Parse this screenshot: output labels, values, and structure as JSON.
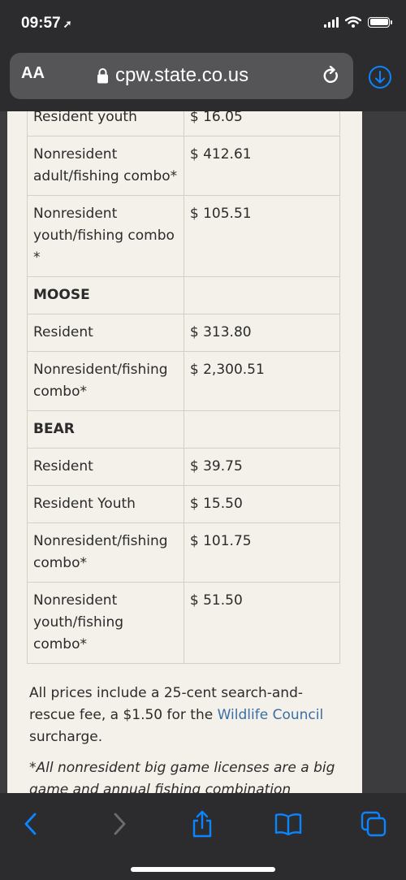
{
  "status_bar": {
    "time": "09:57",
    "location_arrow": "location-arrow-icon"
  },
  "address_bar": {
    "text_size_label": "AA",
    "url": "cpw.state.co.us"
  },
  "table": {
    "cut_row": {
      "label": "Resident youth",
      "price": "$ 16.05"
    },
    "rows": [
      {
        "type": "item",
        "label": "Nonresident adult/fishing combo*",
        "price": "$ 412.61"
      },
      {
        "type": "item",
        "label": "Nonresident youth/fishing combo *",
        "price": "$ 105.51"
      },
      {
        "type": "section",
        "label": "MOOSE",
        "price": ""
      },
      {
        "type": "item",
        "label": "Resident",
        "price": "$ 313.80"
      },
      {
        "type": "item",
        "label": "Nonresident/fishing combo*",
        "price": "$ 2,300.51"
      },
      {
        "type": "section",
        "label": "BEAR",
        "price": ""
      },
      {
        "type": "item",
        "label": "Resident",
        "price": "$ 39.75"
      },
      {
        "type": "item",
        "label": "Resident Youth",
        "price": "$ 15.50"
      },
      {
        "type": "item",
        "label": "Nonresident/fishing combo*",
        "price": "$ 101.75"
      },
      {
        "type": "item",
        "label": "Nonresident youth/fishing combo*",
        "price": "$ 51.50"
      }
    ]
  },
  "footnote": {
    "before_link": "All prices include a 25-cent search-and-rescue fee, a $1.50 for the ",
    "link": "Wildlife Council",
    "after_link": " surcharge."
  },
  "disclaimer": {
    "text": "*All nonresident big game licenses are a big ",
    "trail": "game and annual fishing combination"
  },
  "toolbar": {
    "back": "chevron-left-icon",
    "forward": "chevron-right-icon",
    "share": "share-icon",
    "bookmarks": "book-icon",
    "tabs": "tabs-icon"
  },
  "colors": {
    "accent": "#0a84ff",
    "link": "#3a6ea8",
    "page_bg": "#f4f1ea"
  }
}
